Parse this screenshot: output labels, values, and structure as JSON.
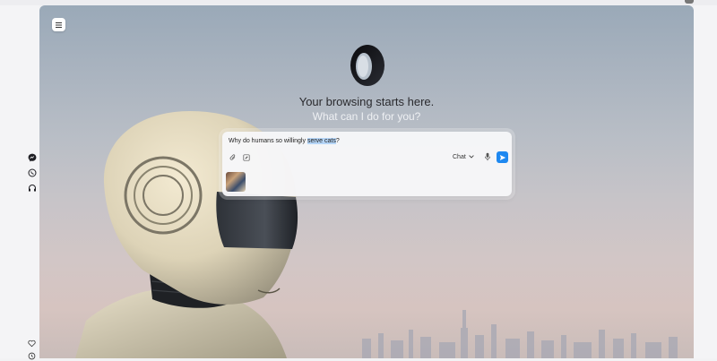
{
  "hero": {
    "headline": "Your browsing starts here.",
    "subline": "What can I do for you?"
  },
  "chat": {
    "prompt_before": "Why do humans so willingly ",
    "prompt_selected": "serve cats",
    "prompt_after": "?",
    "mode_label": "Chat"
  },
  "icons": {
    "menu": "menu-icon",
    "logo": "browser-logo-icon",
    "attach": "paperclip-icon",
    "edit": "edit-icon",
    "mic": "microphone-icon",
    "send": "send-icon",
    "messenger": "messenger-icon",
    "whatsapp": "whatsapp-icon",
    "headphones": "headphones-icon",
    "heart": "heart-icon",
    "history": "clock-icon"
  },
  "colors": {
    "accent": "#1e88f0",
    "selection": "#b5d5f7"
  }
}
